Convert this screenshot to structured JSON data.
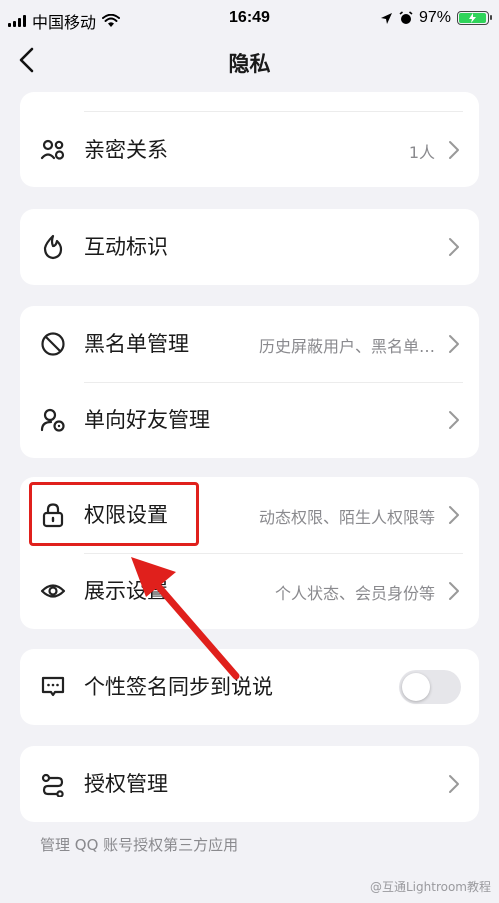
{
  "status_bar": {
    "carrier": "中国移动",
    "time": "16:49",
    "battery": "97%"
  },
  "nav": {
    "title": "隐私"
  },
  "rows": {
    "intimate": {
      "label": "亲密关系",
      "value": "1人"
    },
    "interaction": {
      "label": "互动标识"
    },
    "blacklist": {
      "label": "黑名单管理",
      "value": "历史屏蔽用户、黑名单…"
    },
    "one_way": {
      "label": "单向好友管理"
    },
    "permissions": {
      "label": "权限设置",
      "value": "动态权限、陌生人权限等"
    },
    "display": {
      "label": "展示设置",
      "value": "个人状态、会员身份等"
    },
    "signature_sync": {
      "label": "个性签名同步到说说",
      "enabled": false
    },
    "authorization": {
      "label": "授权管理"
    }
  },
  "footnote": "管理 QQ 账号授权第三方应用",
  "watermark": "@互通Lightroom教程",
  "colors": {
    "highlight": "#e0201c",
    "background": "#f2f2f6",
    "secondary_text": "#8a8a8e"
  }
}
